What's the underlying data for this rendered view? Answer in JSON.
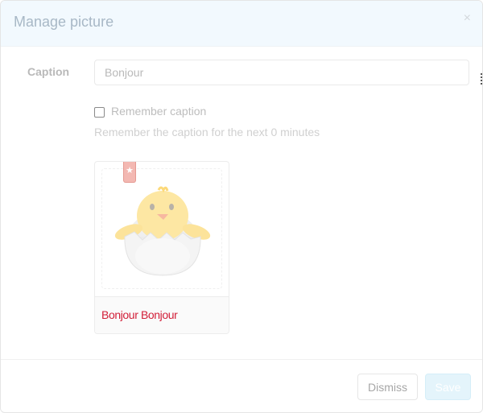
{
  "modal": {
    "title": "Manage picture",
    "close_symbol": "×",
    "close_icon": "close-icon"
  },
  "form": {
    "caption_label": "Caption",
    "caption_value": "Bonjour",
    "remember_label": "Remember caption",
    "remember_checked": false,
    "help_text": "Remember the caption for the next 0 minutes"
  },
  "thumbnail": {
    "image_icon": "hatching-chick-icon",
    "ribbon_icon": "star-icon",
    "ribbon_symbol": "★",
    "caption": "Bonjour Bonjour"
  },
  "footer": {
    "dismiss_label": "Dismiss",
    "save_label": "Save"
  },
  "colors": {
    "header_bg": "#f2f9fe",
    "title_text": "#a8b8c6",
    "caption_text": "#d2203a",
    "save_bg": "#e4f4fb"
  }
}
